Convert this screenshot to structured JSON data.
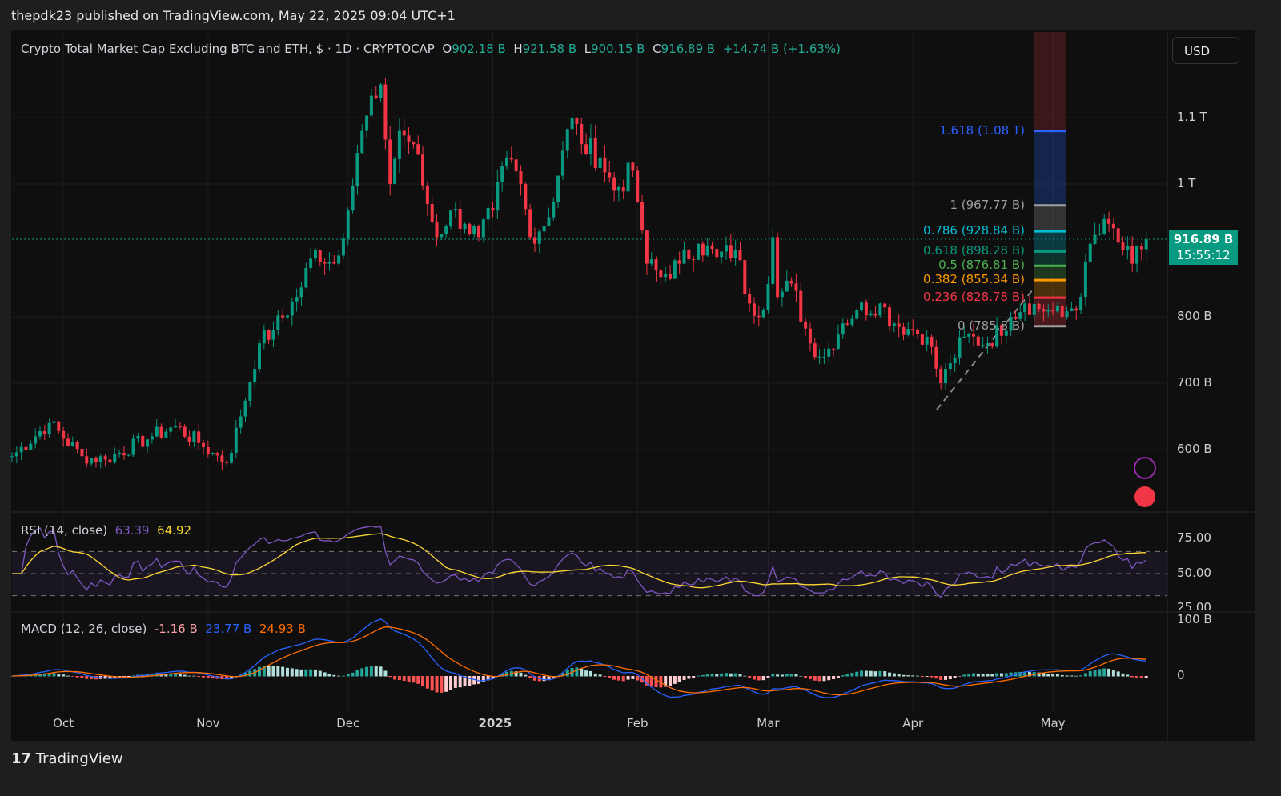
{
  "header": {
    "publisher": "thepdk23 published on TradingView.com, May 22, 2025 09:04 UTC+1"
  },
  "legend": {
    "symbol": "Crypto Total Market Cap Excluding BTC and ETH, $ · 1D · CRYPTOCAP",
    "o_label": "O",
    "o": "902.18 B",
    "h_label": "H",
    "h": "921.58 B",
    "l_label": "L",
    "l": "900.15 B",
    "c_label": "C",
    "c": "916.89 B",
    "change": "+14.74 B (+1.63%)"
  },
  "currency": "USD",
  "price_tag": {
    "price": "916.89 B",
    "countdown": "15:55:12"
  },
  "footer": {
    "brand": "TradingView"
  },
  "chart_data": [
    {
      "type": "candlestick",
      "title": "Crypto Total Market Cap Excluding BTC and ETH",
      "unit": "B USD",
      "y_ticks": [
        {
          "v": 1100,
          "label": "1.1 T"
        },
        {
          "v": 1000,
          "label": "1 T"
        },
        {
          "v": 800,
          "label": "800 B"
        },
        {
          "v": 700,
          "label": "700 B"
        },
        {
          "v": 600,
          "label": "600 B"
        }
      ],
      "x_ticks": [
        {
          "day": 11,
          "label": "Oct"
        },
        {
          "day": 42,
          "label": "Nov"
        },
        {
          "day": 72,
          "label": "Dec"
        },
        {
          "day": 103,
          "label": "2025"
        },
        {
          "day": 134,
          "label": "Feb"
        },
        {
          "day": 162,
          "label": "Mar"
        },
        {
          "day": 193,
          "label": "Apr"
        },
        {
          "day": 223,
          "label": "May"
        }
      ],
      "close_keypoints": [
        [
          0,
          590
        ],
        [
          8,
          640
        ],
        [
          15,
          590
        ],
        [
          20,
          585
        ],
        [
          30,
          620
        ],
        [
          35,
          635
        ],
        [
          40,
          610
        ],
        [
          43,
          595
        ],
        [
          46,
          580
        ],
        [
          49,
          650
        ],
        [
          53,
          760
        ],
        [
          56,
          780
        ],
        [
          61,
          830
        ],
        [
          65,
          900
        ],
        [
          69,
          880
        ],
        [
          72,
          960
        ],
        [
          75,
          1080
        ],
        [
          78,
          1130
        ],
        [
          79,
          1150
        ],
        [
          81,
          1000
        ],
        [
          83,
          1080
        ],
        [
          86,
          1060
        ],
        [
          89,
          970
        ],
        [
          91,
          920
        ],
        [
          94,
          960
        ],
        [
          97,
          940
        ],
        [
          100,
          920
        ],
        [
          103,
          960
        ],
        [
          106,
          1040
        ],
        [
          109,
          1000
        ],
        [
          111,
          920
        ],
        [
          115,
          950
        ],
        [
          118,
          1050
        ],
        [
          120,
          1100
        ],
        [
          122,
          1060
        ],
        [
          126,
          1040
        ],
        [
          129,
          990
        ],
        [
          133,
          1020
        ],
        [
          135,
          930
        ],
        [
          136,
          880
        ],
        [
          139,
          860
        ],
        [
          143,
          880
        ],
        [
          147,
          910
        ],
        [
          151,
          890
        ],
        [
          155,
          900
        ],
        [
          158,
          820
        ],
        [
          161,
          810
        ],
        [
          163,
          920
        ],
        [
          164,
          830
        ],
        [
          167,
          850
        ],
        [
          171,
          760
        ],
        [
          174,
          740
        ],
        [
          178,
          790
        ],
        [
          181,
          810
        ],
        [
          186,
          820
        ],
        [
          189,
          790
        ],
        [
          193,
          780
        ],
        [
          196,
          770
        ],
        [
          199,
          700
        ],
        [
          201,
          730
        ],
        [
          204,
          770
        ],
        [
          209,
          760
        ],
        [
          214,
          800
        ],
        [
          217,
          820
        ],
        [
          222,
          810
        ],
        [
          225,
          800
        ],
        [
          229,
          830
        ],
        [
          231,
          910
        ],
        [
          235,
          940
        ],
        [
          238,
          900
        ],
        [
          240,
          880
        ],
        [
          243,
          917
        ]
      ],
      "fib_levels": [
        {
          "ratio": "1.618",
          "value": "1.08 T",
          "v": 1080,
          "color": "#2962ff"
        },
        {
          "ratio": "1",
          "value": "967.77 B",
          "v": 967.77,
          "color": "#9e9e9e"
        },
        {
          "ratio": "0.786",
          "value": "928.84 B",
          "v": 928.84,
          "color": "#00bcd4"
        },
        {
          "ratio": "0.618",
          "value": "898.28 B",
          "v": 898.28,
          "color": "#089981"
        },
        {
          "ratio": "0.5",
          "value": "876.81 B",
          "v": 876.81,
          "color": "#4caf50"
        },
        {
          "ratio": "0.382",
          "value": "855.34 B",
          "v": 855.34,
          "color": "#ff9800"
        },
        {
          "ratio": "0.236",
          "value": "828.78 B",
          "v": 828.78,
          "color": "#f23645"
        },
        {
          "ratio": "0",
          "value": "785.8 B",
          "v": 785.8,
          "color": "#9e9e9e"
        }
      ]
    },
    {
      "type": "line",
      "title": "RSI (14, close)",
      "rsi": "63.39",
      "ma": "64.92",
      "y_ticks": [
        "75.00",
        "50.00",
        "25.00"
      ],
      "ylim": [
        25,
        75
      ]
    },
    {
      "type": "bar",
      "title": "MACD (12, 26, close)",
      "hist": "-1.16 B",
      "macd": "23.77 B",
      "signal": "24.93 B",
      "y_ticks": [
        "100 B",
        "0"
      ]
    }
  ],
  "colors": {
    "up": "#089981",
    "down": "#f23645",
    "rsi": "#7e57c2",
    "rsi_ma": "#fdd835",
    "macd": "#2962ff",
    "signal": "#ff6d00"
  }
}
